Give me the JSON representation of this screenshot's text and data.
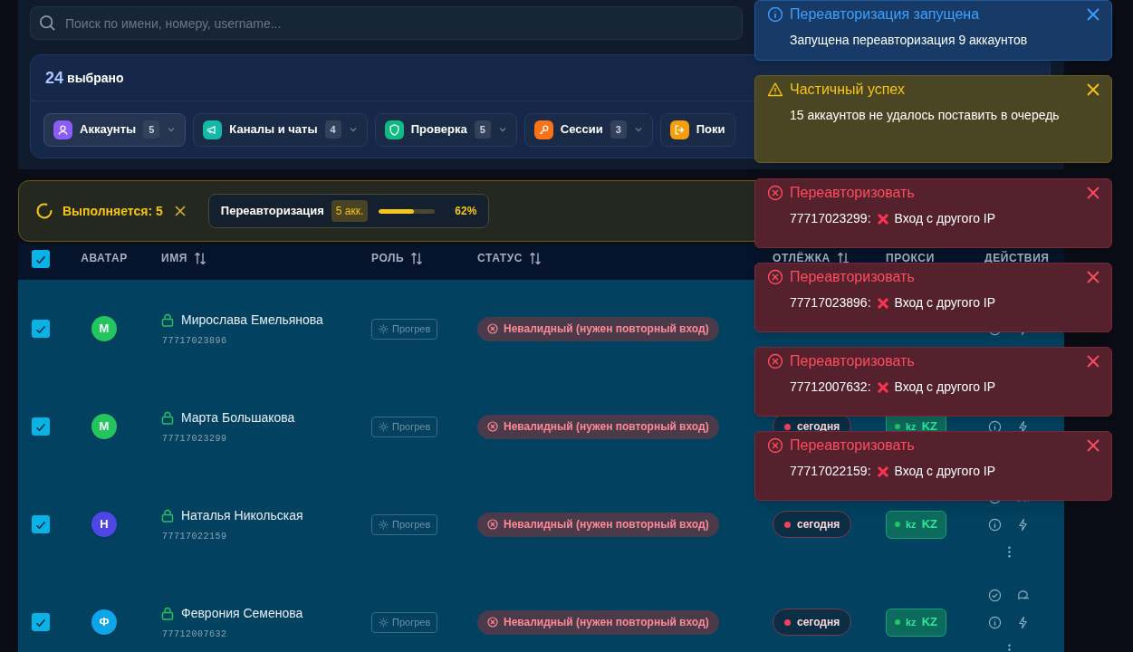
{
  "search": {
    "placeholder": "Поиск по имени, номеру, username..."
  },
  "selection": {
    "count": "24",
    "label": "выбрано",
    "actions": [
      {
        "kind": "accounts",
        "label": "Аккаунты",
        "count": "5",
        "color": "#8b5cf6",
        "selected": true
      },
      {
        "kind": "channels",
        "label": "Каналы и чаты",
        "count": "4",
        "color": "#14b8a6",
        "selected": false
      },
      {
        "kind": "check",
        "label": "Проверка",
        "count": "5",
        "color": "#10b981",
        "selected": false
      },
      {
        "kind": "sessions",
        "label": "Сессии",
        "count": "3",
        "color": "#f97316",
        "selected": false
      },
      {
        "kind": "leave",
        "label": "Поки",
        "color": "#f59e0b",
        "selected": false
      }
    ]
  },
  "running": {
    "label": "Выполняется: 5",
    "tasks": [
      {
        "name": "Переавторизация",
        "badge": "5 акк.",
        "level": 0.62,
        "percent": "62%"
      }
    ]
  },
  "table": {
    "all_checked": true,
    "columns": [
      {
        "label": "АВАТАР",
        "sortable": false
      },
      {
        "label": "ИМЯ",
        "sortable": true
      },
      {
        "label": "РОЛЬ",
        "sortable": true
      },
      {
        "label": "СТАТУС",
        "sortable": true
      },
      {
        "label": "ОТЛЁЖКА",
        "sortable": true
      },
      {
        "label": "ПРОКСИ",
        "sortable": false
      },
      {
        "label": "ДЕЙСТВИЯ",
        "sortable": false
      }
    ],
    "rows": [
      {
        "checked": true,
        "initial": "М",
        "color": "#22c55e",
        "locked": true,
        "name": "Мирослава Емельянова",
        "phone": "77717023896",
        "role": "Прогрев",
        "status": "Невалидный (нужен повторный вход)"
      },
      {
        "checked": true,
        "initial": "М",
        "color": "#22c55e",
        "locked": true,
        "name": "Марта Большакова",
        "phone": "77717023299",
        "role": "Прогрев",
        "status": "Невалидный (нужен повторный вход)",
        "seen": "сегодня",
        "proxy_code": "kz",
        "proxy_label": "KZ"
      },
      {
        "checked": true,
        "initial": "Н",
        "color": "#4f46e5",
        "locked": true,
        "name": "Наталья Никольская",
        "phone": "77717022159",
        "role": "Прогрев",
        "status": "Невалидный (нужен повторный вход)",
        "seen": "сегодня",
        "proxy_code": "kz",
        "proxy_label": "KZ"
      },
      {
        "checked": true,
        "initial": "Ф",
        "color": "#0ea5e9",
        "locked": true,
        "name": "Феврония Семенова",
        "phone": "77712007632",
        "role": "Прогрев",
        "status": "Невалидный (нужен повторный вход)",
        "seen": "сегодня",
        "proxy_code": "kz",
        "proxy_label": "KZ"
      }
    ]
  },
  "toasts": [
    {
      "kind": "info",
      "title": "Переавторизация запущена",
      "message": "Запущена переавторизация 9 аккаунтов"
    },
    {
      "kind": "warning",
      "title": "Частичный успех",
      "message": "15 аккаунтов не удалось поставить в очередь"
    },
    {
      "kind": "error",
      "title": "Переавторизовать",
      "phone": "77717023299:",
      "message": "Вход с другого IP"
    },
    {
      "kind": "error",
      "title": "Переавторизовать",
      "phone": "77717023896:",
      "message": "Вход с другого IP"
    },
    {
      "kind": "error",
      "title": "Переавторизовать",
      "phone": "77712007632:",
      "message": "Вход с другого IP"
    },
    {
      "kind": "error",
      "title": "Переавторизовать",
      "phone": "77717022159:",
      "message": "Вход с другого IP"
    }
  ]
}
